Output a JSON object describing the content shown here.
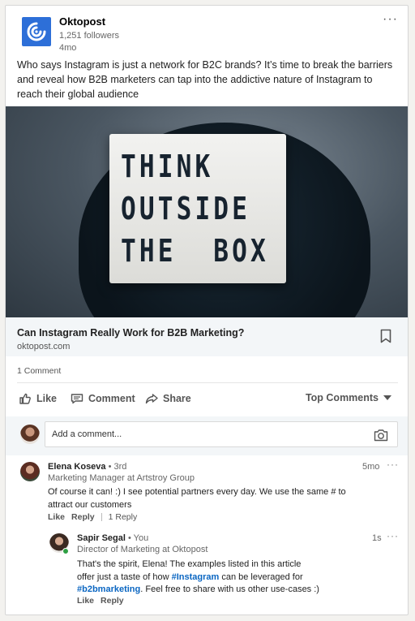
{
  "post": {
    "company": "Oktopost",
    "followers": "1,251 followers",
    "time_ago": "4mo",
    "more_label": "···",
    "text": "Who says Instagram is just a network for B2C brands? It’s time to break the barriers and reveal how B2B marketers can tap into the addictive nature of Instagram to reach their global audience",
    "image_lines": [
      "THINK",
      "OUTSIDE",
      "THE  BOX"
    ],
    "link_title": "Can Instagram Really Work for B2B Marketing?",
    "link_domain": "oktopost.com",
    "comment_count": "1 Comment"
  },
  "actions": {
    "like": "Like",
    "comment": "Comment",
    "share": "Share",
    "sort": "Top Comments"
  },
  "composer": {
    "placeholder": "Add a comment..."
  },
  "comments": [
    {
      "name": "Elena Koseva",
      "degree": " • 3rd",
      "role": "Marketing Manager at Artstroy Group",
      "time": "5mo",
      "text": "Of course it can! :) I see potential partners every day. We use the same # to attract our customers",
      "like": "Like",
      "reply": "Reply",
      "replies": "1 Reply"
    }
  ],
  "reply": {
    "name": "Sapir Segal",
    "degree": " • You",
    "role": "Director of Marketing at Oktopost",
    "time": "1s",
    "text_a": "That's the spirit, Elena! The examples listed in this article offer just a taste of how ",
    "hashtag1": "#Instagram",
    "text_b": " can be leveraged for ",
    "hashtag2": "#b2bmarketing",
    "text_c": ". Feel free to share with us other use-cases :)",
    "like": "Like",
    "reply": "Reply"
  },
  "colors": {
    "brand": "#2d6fd8",
    "hashtag": "#0a66c2",
    "online": "#2ea043"
  }
}
